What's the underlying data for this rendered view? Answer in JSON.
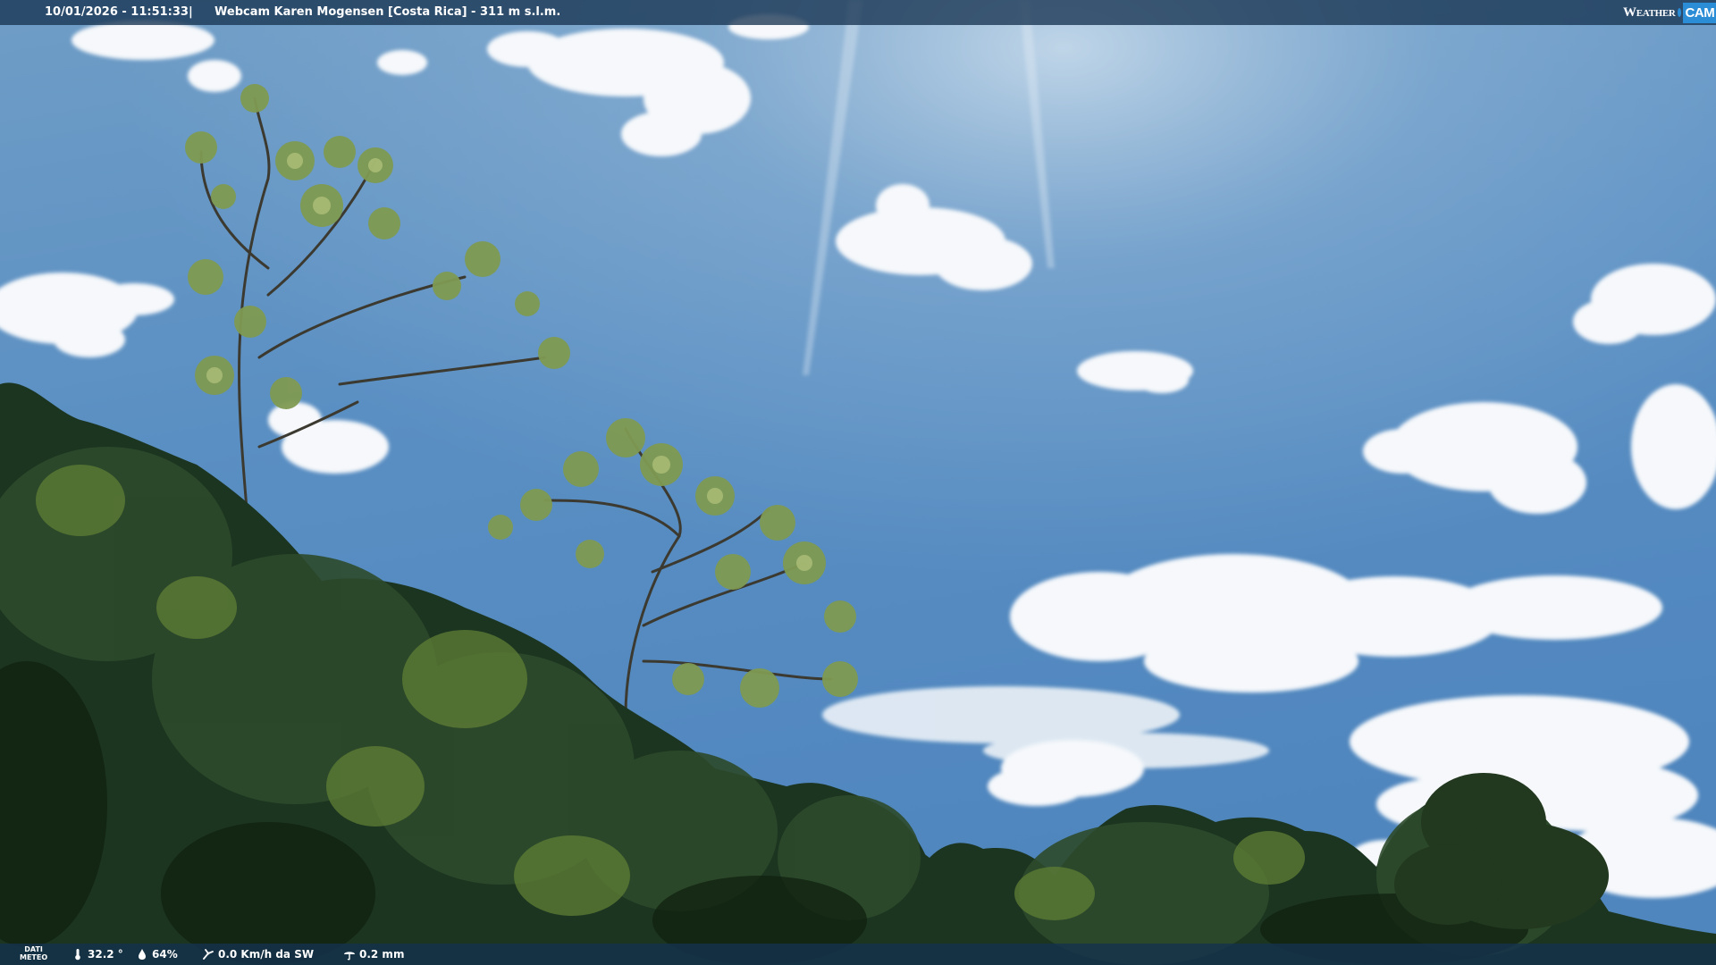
{
  "overlay": {
    "timestamp": "10/01/2026 - 11:51:33",
    "separator": "|",
    "camera_title": "Webcam Karen Mogensen [Costa Rica]  - 311 m s.l.m.",
    "logo": {
      "word": "Weather",
      "cam": "CAM"
    }
  },
  "weather_data": {
    "label_line1": "DATI",
    "label_line2": "METEO",
    "temperature": "32.2 °",
    "humidity": "64%",
    "wind": "0.0 Km/h da SW",
    "rain": "0.2 mm"
  },
  "icons": [
    "thermometer-icon",
    "humidity-drop-icon",
    "wind-icon",
    "rain-icon"
  ],
  "colors": {
    "sky_top": "#5e8fbe",
    "sky_bottom": "#4d86c0",
    "bar": "#183452",
    "logo_blue": "#2b8dd6",
    "foliage_dark": "#1f3a22",
    "foliage_light": "#6b8f45"
  }
}
